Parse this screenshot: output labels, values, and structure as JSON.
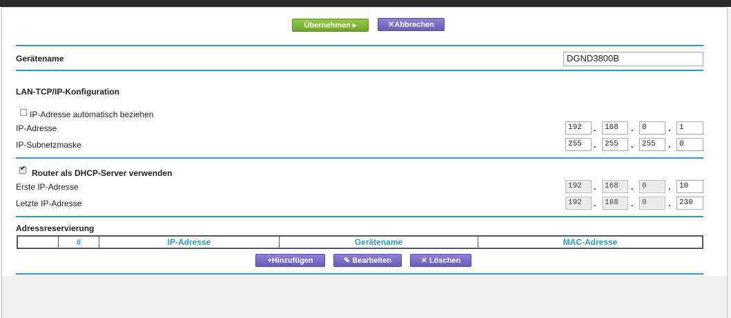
{
  "toolbar": {
    "apply_label": "Übernehmen ▸",
    "cancel_label": "Abbrechen"
  },
  "device_name": {
    "label": "Gerätename",
    "value": "DGND3800B"
  },
  "lan": {
    "title": "LAN-TCP/IP-Konfiguration",
    "auto_ip_label": "IP-Adresse automatisch beziehen",
    "auto_ip_checked": false,
    "ip_label": "IP-Adresse",
    "ip": [
      "192",
      "168",
      "0",
      "1"
    ],
    "subnet_label": "IP-Subnetzmaske",
    "subnet": [
      "255",
      "255",
      "255",
      "0"
    ]
  },
  "dhcp": {
    "enable_label": "Router als DHCP-Server verwenden",
    "enabled": true,
    "first_label": "Erste IP-Adresse",
    "first": [
      "192",
      "168",
      "0",
      "10"
    ],
    "last_label": "Letzte IP-Adresse",
    "last": [
      "192",
      "168",
      "0",
      "230"
    ]
  },
  "reservation": {
    "title": "Adressreservierung",
    "columns": [
      "",
      "#",
      "IP-Adresse",
      "Gerätename",
      "MAC-Adresse"
    ],
    "add_label": "Hinzufügen",
    "edit_label": "Bearbeiten",
    "delete_label": "Löschen"
  },
  "colors": {
    "accent": "#2b9bc6",
    "apply": "#7cb63a",
    "secondary": "#7b6ec6"
  },
  "icons": [
    "check-icon",
    "close-icon",
    "plus-icon",
    "pencil-icon"
  ]
}
